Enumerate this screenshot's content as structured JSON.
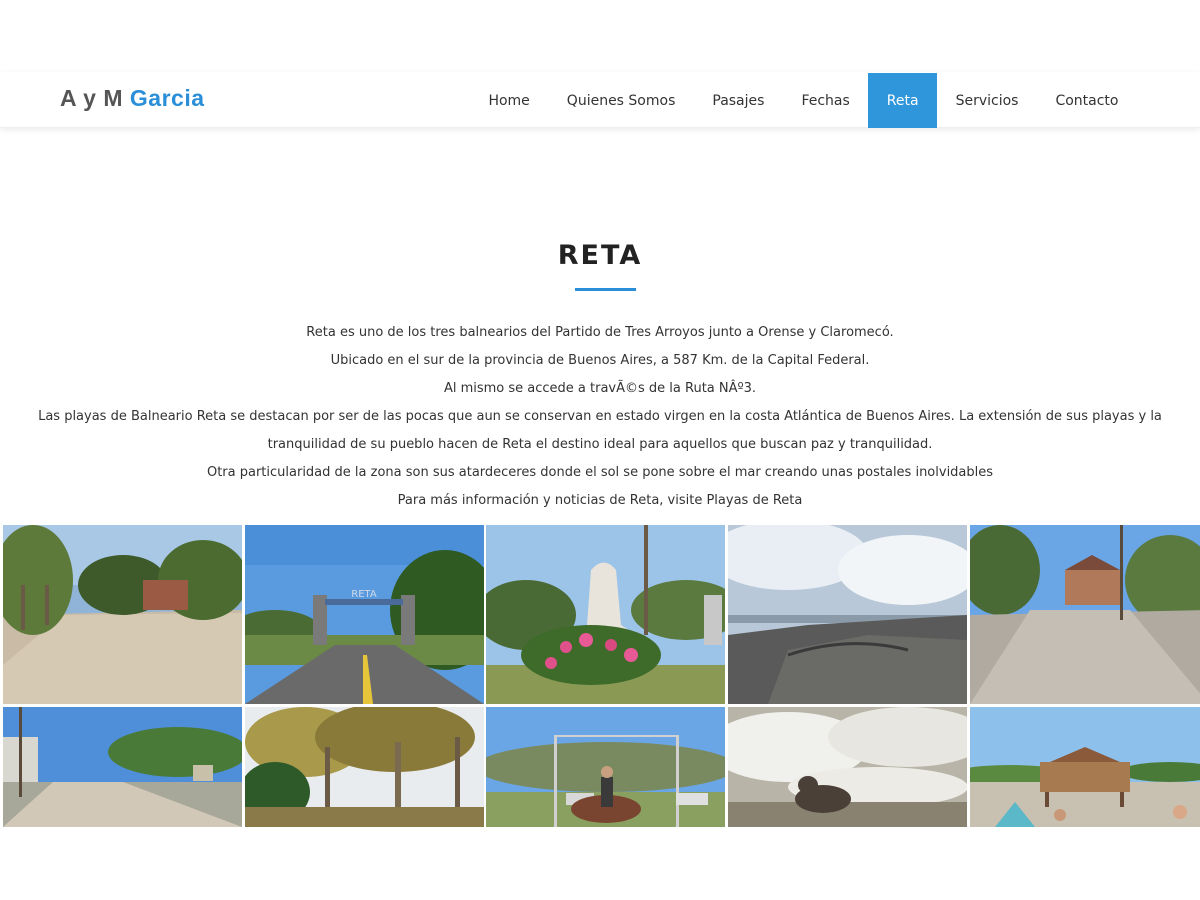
{
  "header": {
    "logo_part1": "A y M",
    "logo_part2": "Garcia",
    "nav": [
      {
        "label": "Home",
        "active": false
      },
      {
        "label": "Quienes Somos",
        "active": false
      },
      {
        "label": "Pasajes",
        "active": false
      },
      {
        "label": "Fechas",
        "active": false
      },
      {
        "label": "Reta",
        "active": true
      },
      {
        "label": "Servicios",
        "active": false
      },
      {
        "label": "Contacto",
        "active": false
      }
    ]
  },
  "main": {
    "title": "RETA",
    "paragraphs": [
      "Reta es uno de los tres balnearios del Partido de Tres Arroyos junto a Orense y Claromecó.",
      "Ubicado en el sur de la provincia de Buenos Aires, a 587 Km. de la Capital Federal.",
      "Al mismo se accede a travÃ©s de la Ruta NÂº3.",
      "Las playas de Balneario Reta se destacan por ser de las pocas que aun se conservan en estado virgen en la costa Atlántica de Buenos Aires. La extensión de sus playas y la tranquilidad de su pueblo hacen de Reta el destino ideal para aquellos que buscan paz y tranquilidad.",
      "Otra particularidad de la zona son sus atardeceres donde el sol se pone sobre el mar creando unas postales inolvidables",
      "Para más información y noticias de Reta, visite Playas de Reta"
    ]
  },
  "colors": {
    "accent": "#2a8fd8",
    "nav_active_bg": "#2f96dc",
    "text": "#333333"
  },
  "gallery": {
    "photos": [
      {
        "subject": "dirt-road-with-trees"
      },
      {
        "subject": "paved-road-entrance-gate",
        "sign_text": "RETA"
      },
      {
        "subject": "statue-with-flowers"
      },
      {
        "subject": "sand-dunes-cloudy-sky"
      },
      {
        "subject": "street-with-houses"
      },
      {
        "subject": "sandy-street-power-lines"
      },
      {
        "subject": "forest-trees-sunset"
      },
      {
        "subject": "rider-on-horse"
      },
      {
        "subject": "sea-lion-on-beach-foam"
      },
      {
        "subject": "beach-bar-with-people"
      }
    ]
  }
}
